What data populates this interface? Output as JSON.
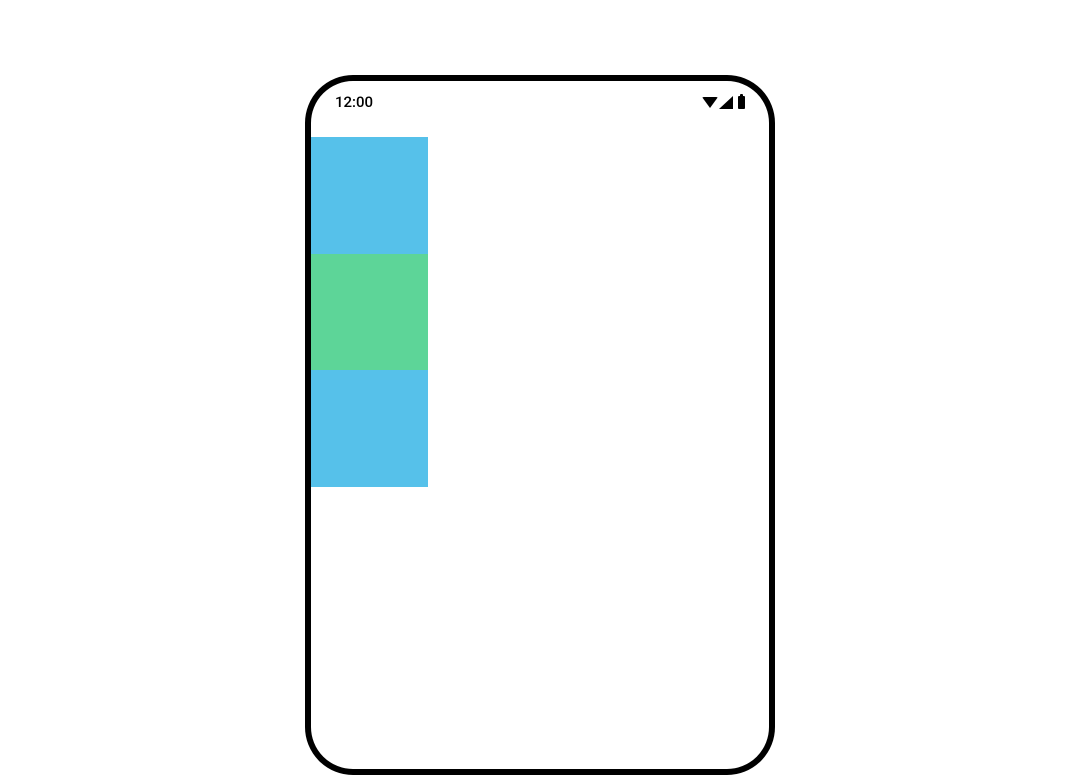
{
  "statusBar": {
    "time": "12:00"
  },
  "blocks": {
    "topColor": "#56c1ea",
    "midColor": "#5dd598",
    "botColor": "#56c1ea"
  }
}
